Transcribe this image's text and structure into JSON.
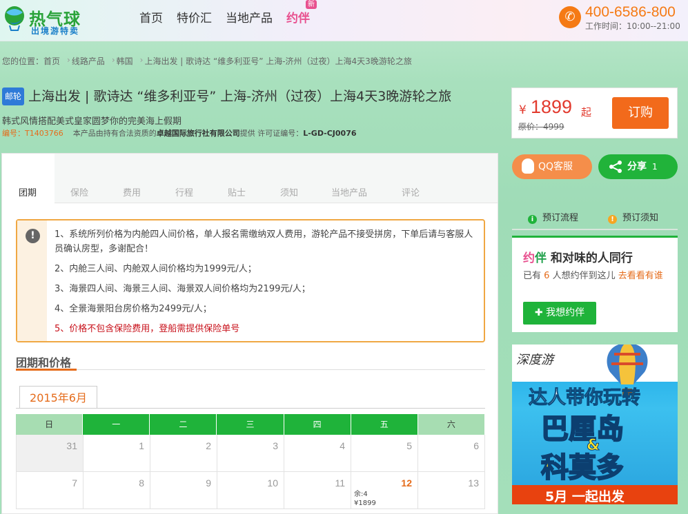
{
  "header": {
    "logo_main": "热气球",
    "logo_sub": "出境游特卖",
    "nav": [
      "首页",
      "特价汇",
      "当地产品",
      "约伴"
    ],
    "nav_new_badge": "新",
    "phone": "400-6586-800",
    "work_time": "工作时间：10:00--21:00"
  },
  "breadcrumb": [
    "您的位置：首页",
    "线路产品",
    "韩国",
    "上海出发 | 歌诗达 “维多利亚号” 上海-济州（过夜）上海4天3晚游轮之旅"
  ],
  "product": {
    "badge": "邮轮",
    "title": "上海出发 | 歌诗达 “维多利亚号” 上海-济州（过夜）上海4天3晚游轮之旅",
    "subtitle": "韩式风情搭配美式皇家圆梦你的完美海上假期",
    "code_label": "编号：",
    "code": "T1403766",
    "provider_prefix": "本产品由持有合法资质的",
    "provider": "卓越国际旅行社有限公司",
    "provider_suffix": "提供 许可证编号：",
    "license": "L-GD-CJ0076"
  },
  "price": {
    "currency": "¥",
    "value": "1899",
    "suffix": "起",
    "original": "原价：4999",
    "order_label": "订购"
  },
  "tabs": [
    "团期",
    "保险",
    "费用",
    "行程",
    "贴士",
    "须知",
    "当地产品",
    "评论"
  ],
  "notice": {
    "icon": "!",
    "items": [
      "1、系统所列价格为内舱四人间价格，单人报名需缴纳双人费用，游轮产品不接受拼房，下单后请与客服人员确认房型，多谢配合！",
      "2、内舱三人间、内舱双人间价格均为1999元/人；",
      "3、海景四人间、海景三人间、海景双人间价格均为2199元/人；",
      "4、全景海景阳台房价格为2499元/人；",
      "5、价格不包含保险费用，登船需提供保险单号"
    ]
  },
  "section_title": "团期和价格",
  "calendar": {
    "month": "2015年6月",
    "weekdays": [
      "日",
      "一",
      "二",
      "三",
      "四",
      "五",
      "六"
    ],
    "row1": [
      "31",
      "1",
      "2",
      "3",
      "4",
      "5",
      "6"
    ],
    "row2": [
      "7",
      "8",
      "9",
      "10",
      "11",
      "12",
      "13"
    ],
    "highlight_remain": "余:4",
    "highlight_price": "¥1899"
  },
  "sidebar": {
    "qq_label": "QQ客服",
    "share_label": "分享",
    "share_count": "1",
    "order_flow": "预订流程",
    "order_notice": "预订须知",
    "yueban_brand1": "约",
    "yueban_brand2": "伴",
    "yueban_title": "和对味的人同行",
    "yueban_text_prefix": "已有",
    "yueban_count": "6",
    "yueban_text_middle": "人想约伴到这儿",
    "yueban_link": "去看看有谁",
    "yueban_btn": "我想约伴"
  },
  "ad": {
    "brand": "深度游",
    "line1_a": "达人带你",
    "line1_b": "玩转",
    "line2": "巴厘岛",
    "amp": "&",
    "line3": "科莫多",
    "line4": "5月 一起出发"
  },
  "colors": {
    "accent_orange": "#f26a1b",
    "accent_green": "#1fb33a",
    "price_red": "#e23a2e",
    "brand_pink": "#e8508f"
  }
}
